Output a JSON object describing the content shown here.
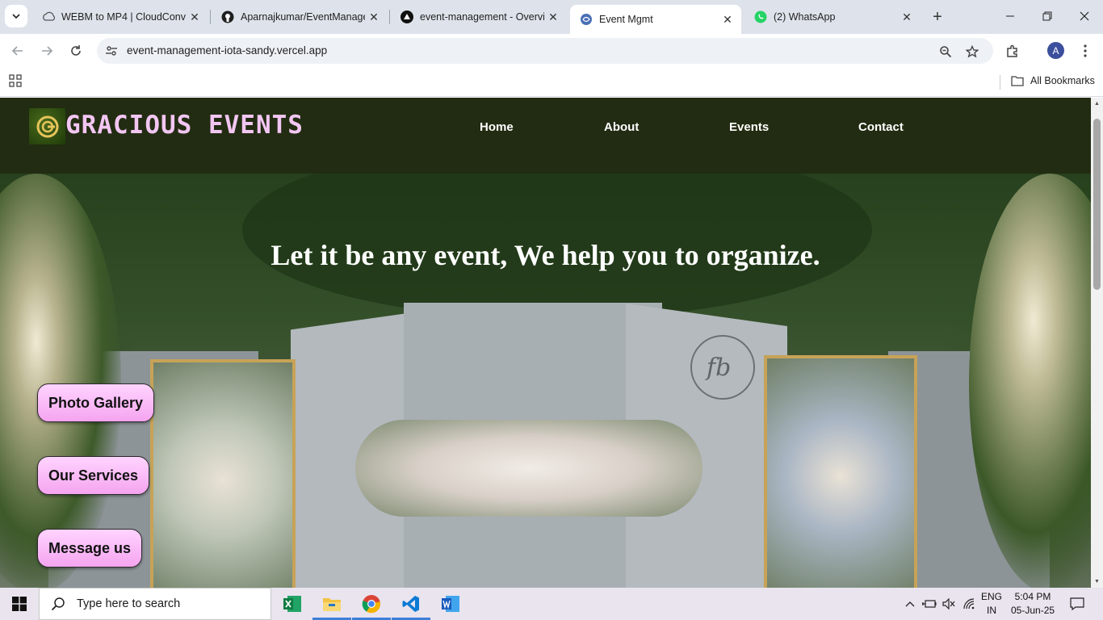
{
  "browser": {
    "tabs": [
      {
        "title": "WEBM to MP4 | CloudConve",
        "icon": "cloudconvert-icon"
      },
      {
        "title": "Aparnajkumar/EventManage",
        "icon": "github-icon"
      },
      {
        "title": "event-management - Overvi",
        "icon": "vercel-icon"
      },
      {
        "title": "Event Mgmt",
        "icon": "globe-icon",
        "active": true
      },
      {
        "title": "(2) WhatsApp",
        "icon": "whatsapp-icon"
      }
    ],
    "address_bar": {
      "url": "event-management-iota-sandy.vercel.app"
    },
    "profile_initial": "A",
    "bookmarks": {
      "all_label": "All Bookmarks"
    }
  },
  "site": {
    "brand": "GRACIOUS EVENTS",
    "nav": [
      "Home",
      "About",
      "Events",
      "Contact"
    ],
    "hero_title": "Let it be any event, We help you to organize.",
    "buttons": [
      "Photo Gallery",
      "Our Services",
      "Message us"
    ],
    "colors": {
      "header_bg": "#222c12",
      "brand_text": "#f2c6f2",
      "button_bg": "#f5a4ef"
    }
  },
  "taskbar": {
    "search_placeholder": "Type here to search",
    "lang_top": "ENG",
    "lang_bottom": "IN",
    "time": "5:04 PM",
    "date": "05-Jun-25"
  }
}
